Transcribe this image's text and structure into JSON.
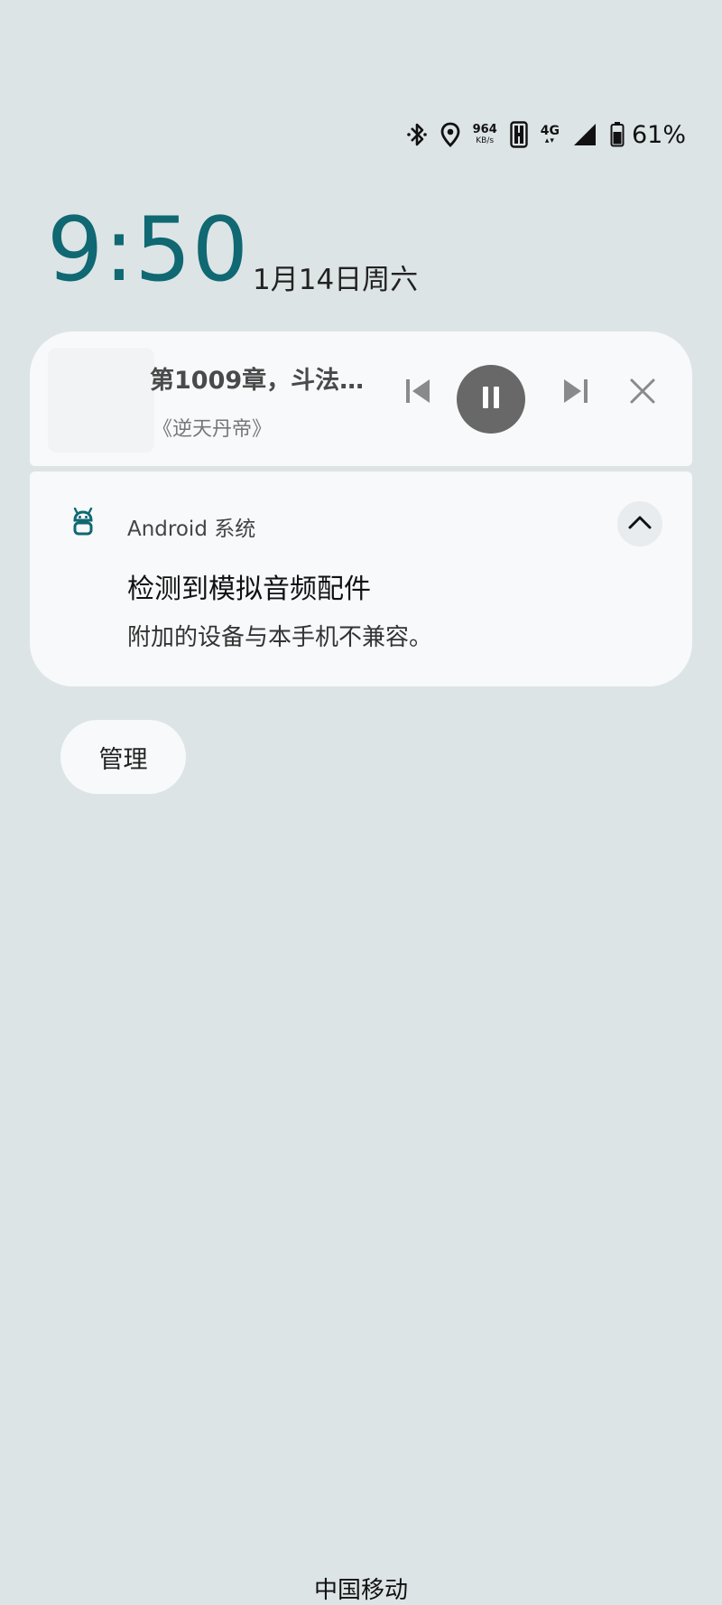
{
  "status_bar": {
    "net_speed_value": "964",
    "net_speed_unit": "KB/s",
    "network_type": "4G",
    "battery_percent": "61%",
    "icons": [
      "bluetooth-icon",
      "location-icon",
      "hd-icon",
      "signal-icon",
      "battery-icon"
    ]
  },
  "lockscreen": {
    "time": "9:50",
    "date": "1月14日周六"
  },
  "media": {
    "title": "第1009章，斗法…",
    "subtitle": "《逆天丹帝》",
    "icons": [
      "previous-icon",
      "pause-icon",
      "next-icon",
      "close-icon"
    ]
  },
  "notification": {
    "app_name": "Android 系统",
    "title": "检测到模拟音频配件",
    "text": "附加的设备与本手机不兼容。"
  },
  "manage_label": "管理",
  "carrier": "中国移动",
  "colors": {
    "background": "#dde4e6",
    "clock": "#0f6872",
    "card": "#f7f9fa",
    "play_button": "#686868"
  }
}
